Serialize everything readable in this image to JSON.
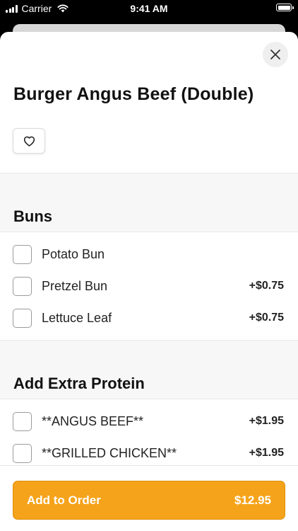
{
  "status_bar": {
    "carrier": "Carrier",
    "time": "9:41 AM"
  },
  "item": {
    "title": "Burger Angus Beef (Double)"
  },
  "sections": [
    {
      "title": "Buns",
      "options": [
        {
          "label": "Potato Bun",
          "price": ""
        },
        {
          "label": "Pretzel Bun",
          "price": "+$0.75"
        },
        {
          "label": "Lettuce Leaf",
          "price": "+$0.75"
        }
      ]
    },
    {
      "title": "Add Extra Protein",
      "options": [
        {
          "label": "**ANGUS BEEF**",
          "price": "+$1.95"
        },
        {
          "label": "**GRILLED CHICKEN**",
          "price": "+$1.95"
        }
      ]
    }
  ],
  "footer": {
    "add_label": "Add to Order",
    "total": "$12.95"
  },
  "colors": {
    "accent": "#f5a31a",
    "status_bar_bg": "#000000",
    "section_bg": "#f7f7f7"
  },
  "icons": {
    "close": "close-icon",
    "favorite": "heart-icon",
    "signal": "signal-icon",
    "wifi": "wifi-icon",
    "battery": "battery-icon"
  }
}
